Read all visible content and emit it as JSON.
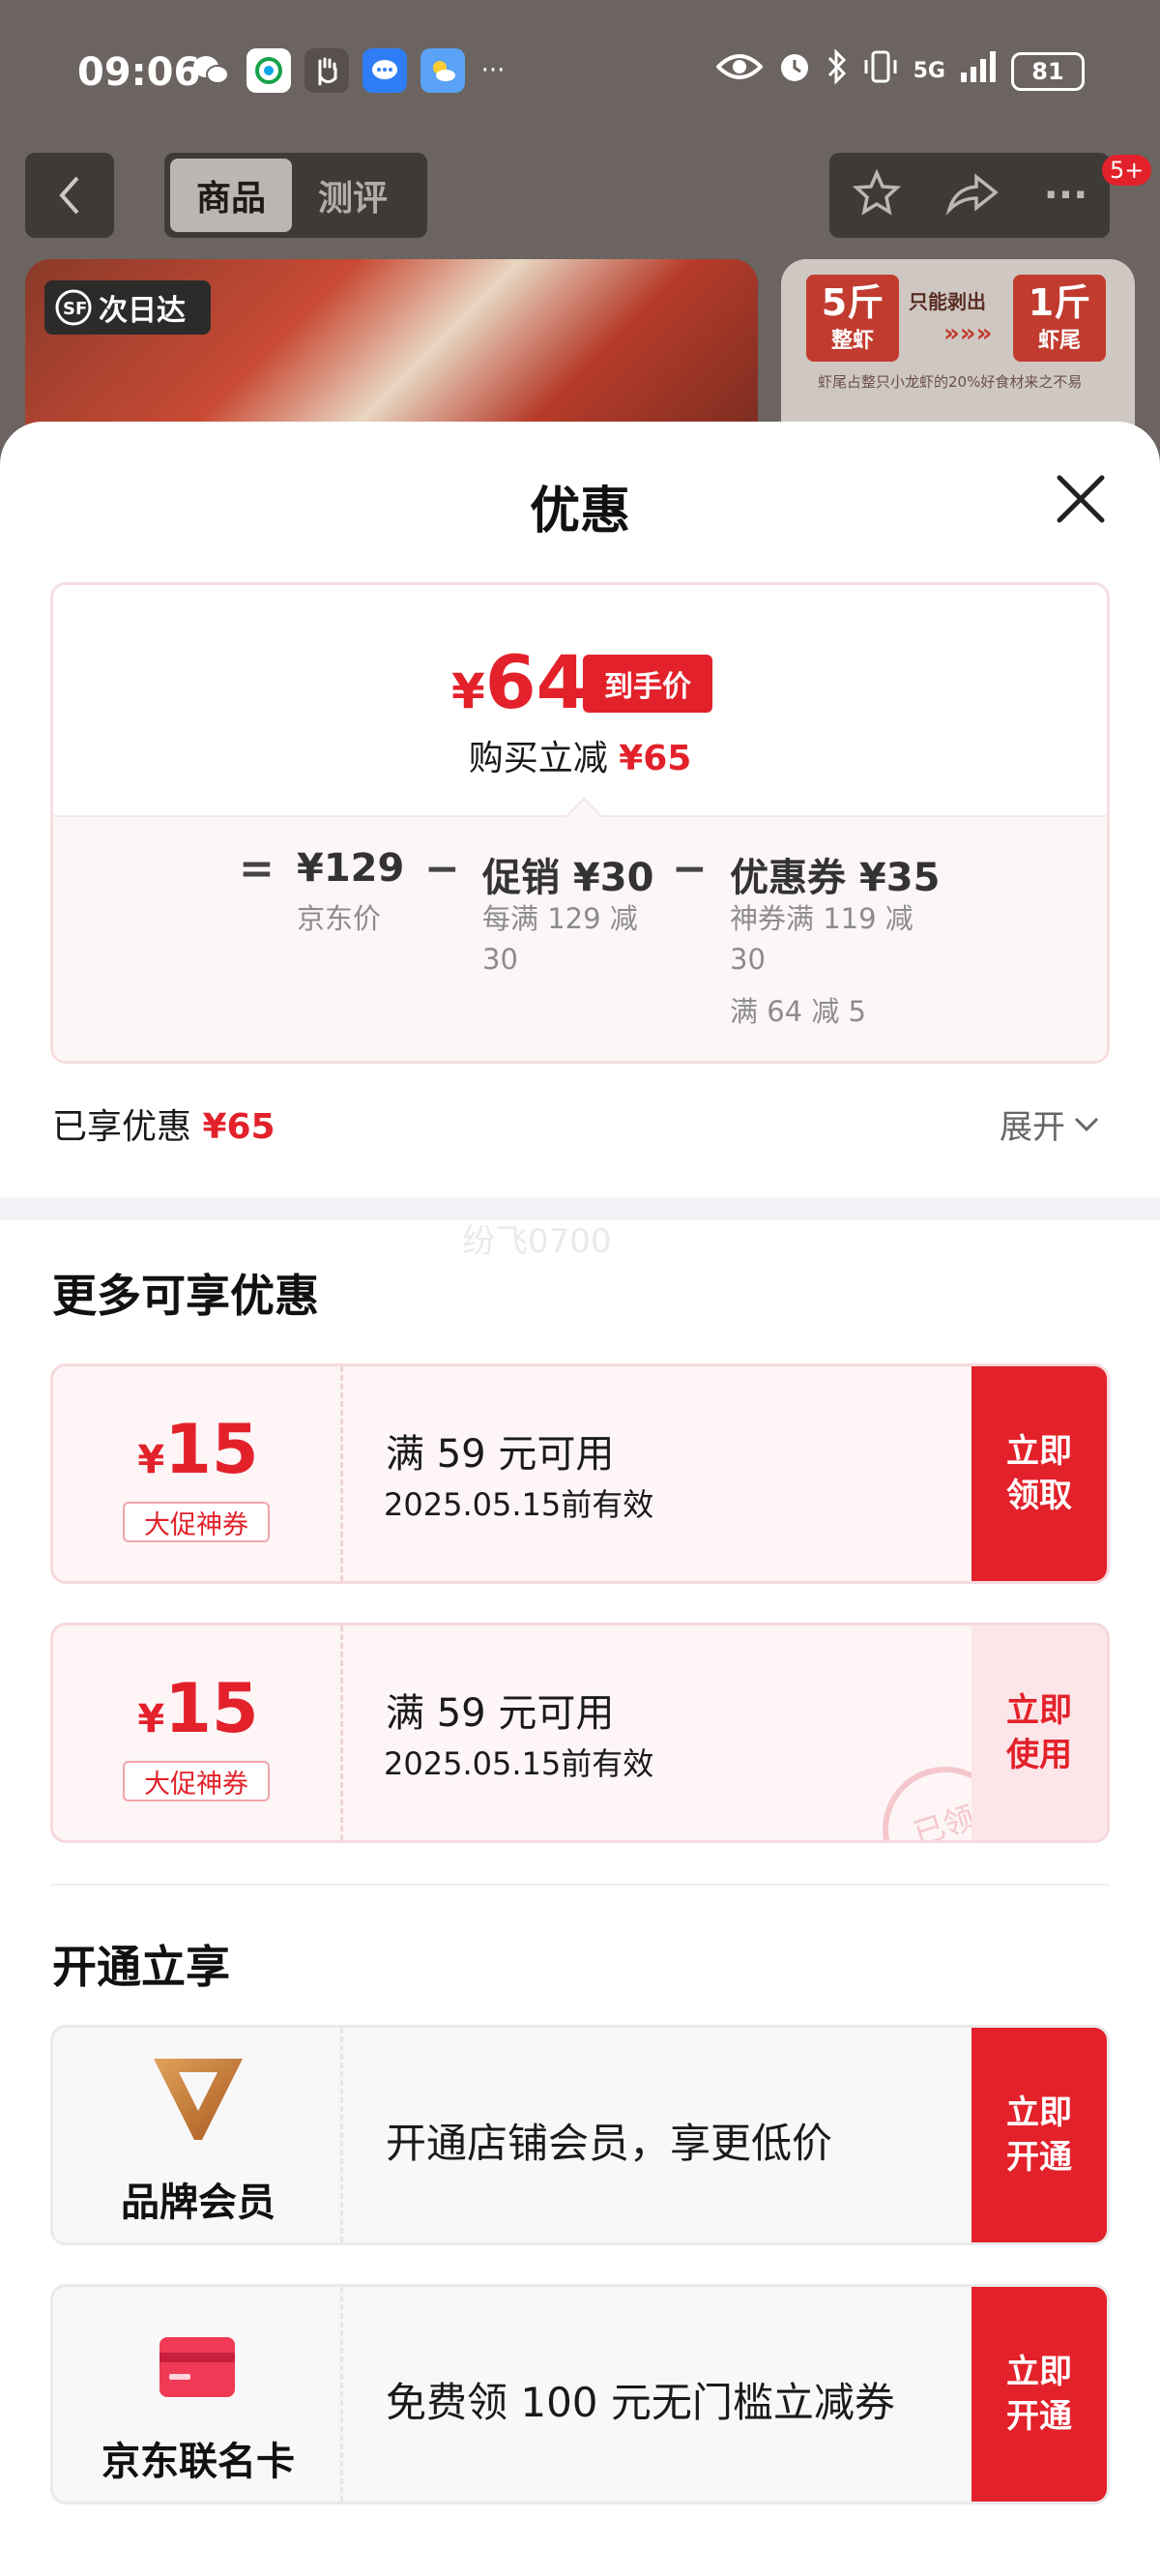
{
  "status_bar": {
    "time": "09:06",
    "network": "5G",
    "battery": "81"
  },
  "nav": {
    "tabs": [
      "商品",
      "测评"
    ],
    "badge": "5+"
  },
  "background": {
    "logo_text": "次日达",
    "tag_left_big": "5斤",
    "tag_left_small": "整虾",
    "tag_mid": "只能剥出",
    "tag_arrows": "»»»",
    "tag_right_big": "1斤",
    "tag_right_small": "虾尾",
    "caption": "虾尾占整只小龙虾的20%好食材来之不易"
  },
  "sheet": {
    "title": "优惠"
  },
  "price_card": {
    "yen": "¥",
    "final_price": "64",
    "final_tag": "到手价",
    "save_prefix": "购买立减 ",
    "save_amount": "¥65",
    "calc": {
      "eq": "=",
      "minus": "−",
      "jd_price": "¥129",
      "jd_label": "京东价",
      "promo_value": "促销 ¥30",
      "promo_sub_1": "每满 129 减",
      "promo_sub_2": "30",
      "coupon_value": "优惠券 ¥35",
      "coupon_sub_1": "神券满 119 减",
      "coupon_sub_2": "30",
      "coupon_sub_3": "满 64 减 5"
    }
  },
  "enjoyed": {
    "label": "已享优惠 ",
    "amount": "¥65",
    "expand": "展开"
  },
  "watermark": "纷飞0700",
  "more_section": {
    "title": "更多可享优惠",
    "coupons": [
      {
        "yen": "¥",
        "amount": "15",
        "label": "大促神券",
        "condition": "满 59 元可用",
        "validity": "2025.05.15前有效",
        "button_line1": "立即",
        "button_line2": "领取",
        "stamp": ""
      },
      {
        "yen": "¥",
        "amount": "15",
        "label": "大促神券",
        "condition": "满 59 元可用",
        "validity": "2025.05.15前有效",
        "button_line1": "立即",
        "button_line2": "使用",
        "stamp": "已领"
      }
    ]
  },
  "open_section": {
    "title": "开通立享",
    "items": [
      {
        "name": "品牌会员",
        "desc": "开通店铺会员，享更低价",
        "button_line1": "立即",
        "button_line2": "开通"
      },
      {
        "name": "京东联名卡",
        "desc": "免费领 100 元无门槛立减券",
        "button_line1": "立即",
        "button_line2": "开通"
      }
    ]
  },
  "colors": {
    "accent_red": "#e3212a",
    "pink_bg": "#fdf5f6",
    "gold": "#c8812f"
  }
}
